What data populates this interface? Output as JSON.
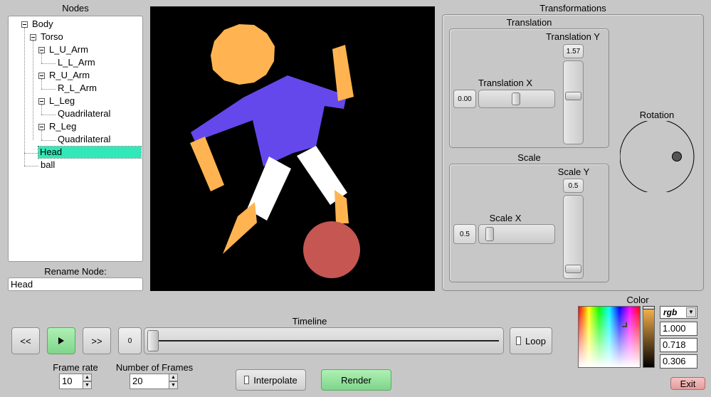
{
  "nodes_panel": {
    "title": "Nodes",
    "tree": [
      {
        "label": "Body"
      },
      {
        "label": "Torso"
      },
      {
        "label": "L_U_Arm"
      },
      {
        "label": "L_L_Arm"
      },
      {
        "label": "R_U_Arm"
      },
      {
        "label": "R_L_Arm"
      },
      {
        "label": "L_Leg"
      },
      {
        "label": "Quadrilateral"
      },
      {
        "label": "R_Leg"
      },
      {
        "label": "Quadrilateral"
      },
      {
        "label": "Head"
      },
      {
        "label": "ball"
      }
    ],
    "selected": "Head",
    "rename_label": "Rename Node:",
    "rename_value": "Head"
  },
  "canvas": {
    "background": "#000000",
    "head_color": "#ffb451",
    "torso_color": "#6548ec",
    "leg_color": "#ffffff",
    "limb_color": "#ffb451",
    "ball_color": "#c55651"
  },
  "transformations": {
    "title": "Transformations",
    "translation": {
      "title": "Translation",
      "x_label": "Translation X",
      "x_value": "0.00",
      "y_label": "Translation Y",
      "y_value": "1.57"
    },
    "scale": {
      "title": "Scale",
      "x_label": "Scale X",
      "x_value": "0.5",
      "y_label": "Scale Y",
      "y_value": "0.5"
    },
    "rotation": {
      "label": "Rotation"
    }
  },
  "timeline": {
    "title": "Timeline",
    "rewind_label": "<<",
    "play_icon": "play-icon",
    "forward_label": ">>",
    "frame_value": "0",
    "loop_label": "Loop",
    "frame_rate_label": "Frame rate",
    "frame_rate_value": "10",
    "num_frames_label": "Number of Frames",
    "num_frames_value": "20",
    "interpolate_label": "Interpolate",
    "render_label": "Render"
  },
  "color_picker": {
    "title": "Color",
    "mode": "rgb",
    "r": "1.000",
    "g": "0.718",
    "b": "0.306",
    "selected_color": "#ffb74e"
  },
  "exit_label": "Exit"
}
